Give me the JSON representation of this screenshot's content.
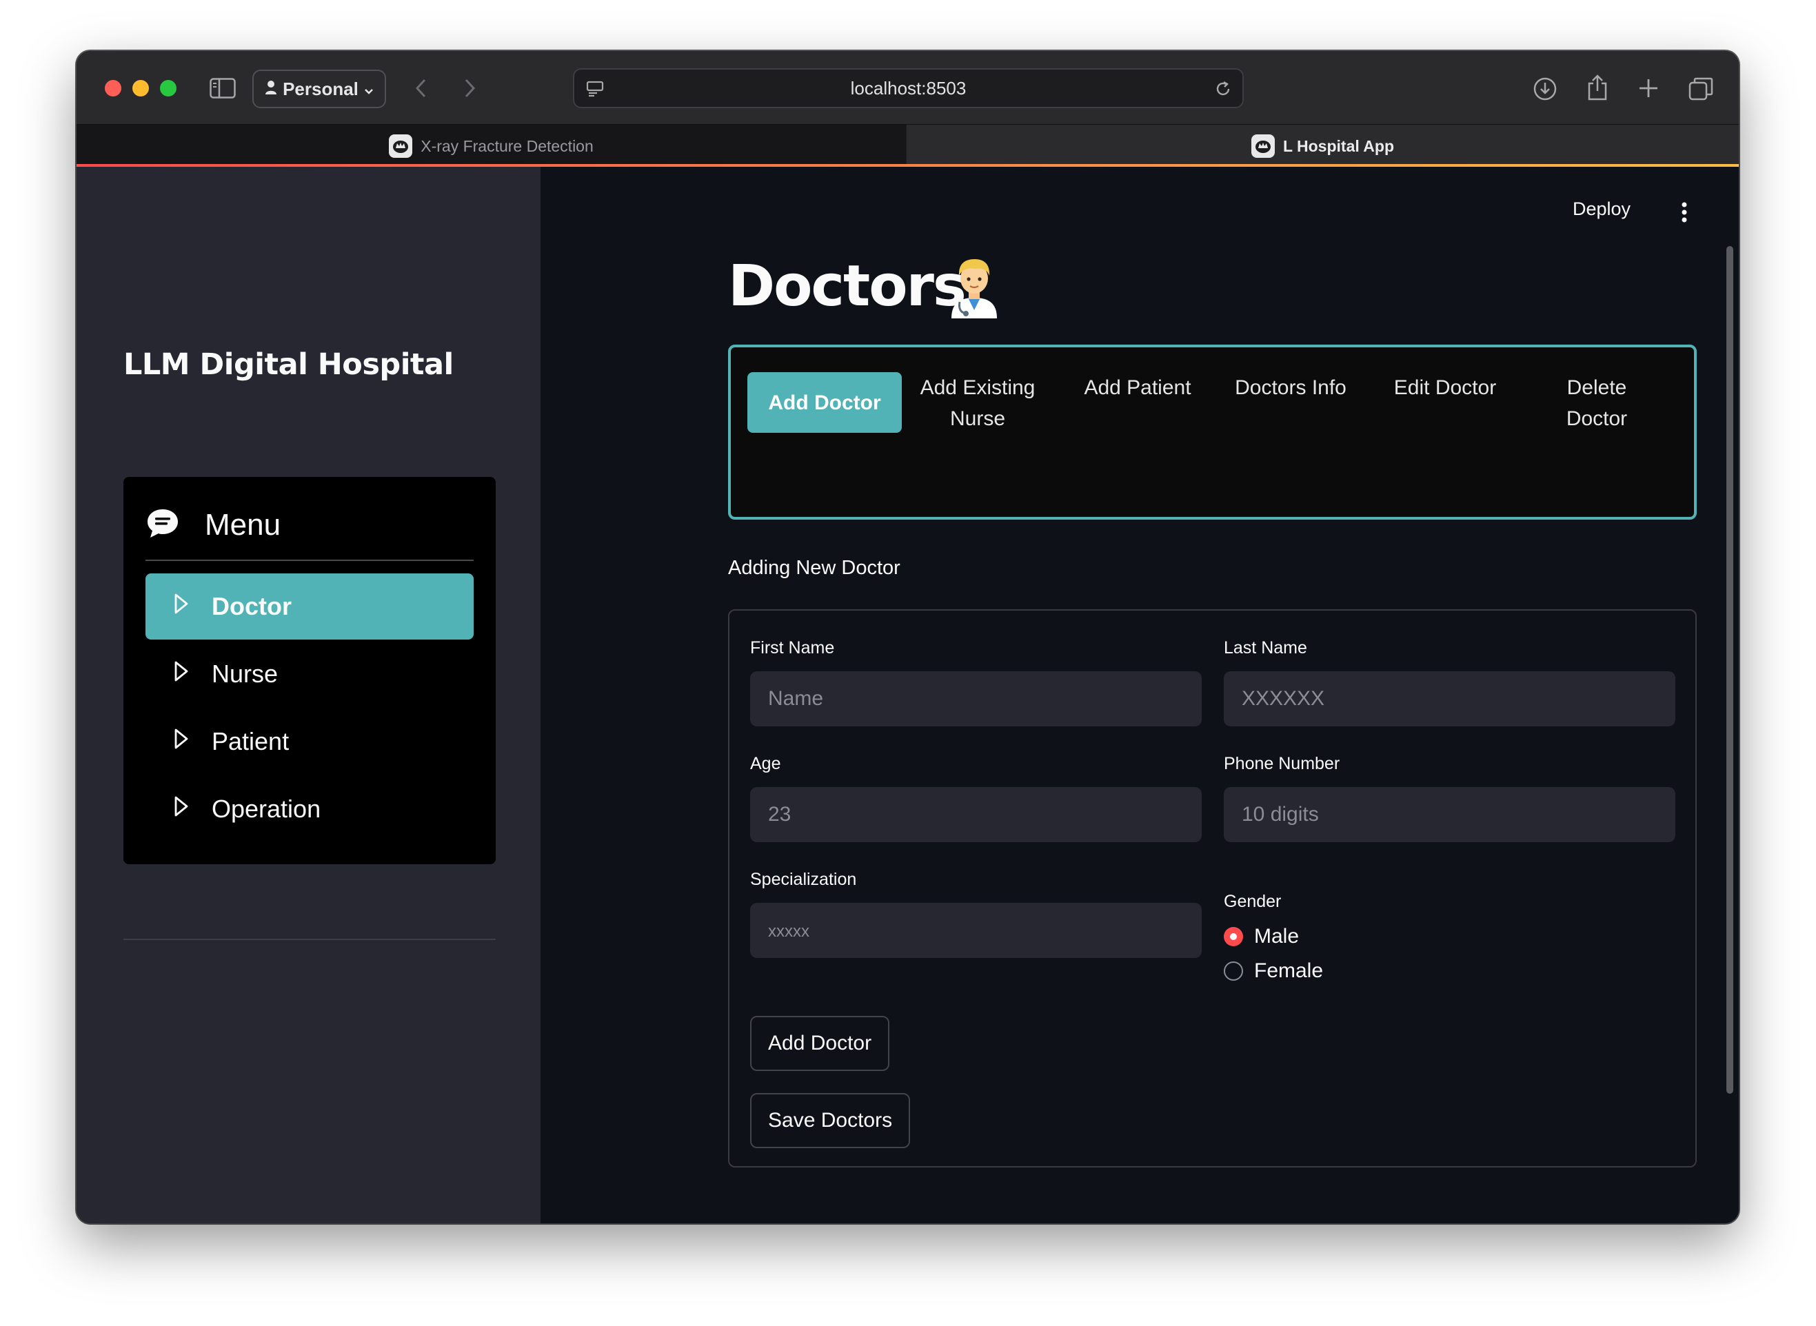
{
  "browser": {
    "profile_label": "Personal",
    "url": "localhost:8503",
    "tabs": [
      {
        "title": "X-ray Fracture Detection"
      },
      {
        "title": "L Hospital App"
      }
    ]
  },
  "sidebar": {
    "title": "LLM Digital Hospital",
    "menu_title": "Menu",
    "items": [
      {
        "label": "Doctor"
      },
      {
        "label": "Nurse"
      },
      {
        "label": "Patient"
      },
      {
        "label": "Operation"
      }
    ]
  },
  "header": {
    "deploy_label": "Deploy"
  },
  "page": {
    "title": "Doctors",
    "subnav": [
      {
        "label": "Add Doctor"
      },
      {
        "label": "Add Existing Nurse"
      },
      {
        "label": "Add Patient"
      },
      {
        "label": "Doctors Info"
      },
      {
        "label": "Edit Doctor"
      },
      {
        "label": "Delete Doctor"
      }
    ],
    "section_heading": "Adding New Doctor"
  },
  "form": {
    "first_name": {
      "label": "First Name",
      "placeholder": "Name"
    },
    "last_name": {
      "label": "Last Name",
      "placeholder": "XXXXXX"
    },
    "age": {
      "label": "Age",
      "placeholder": "23"
    },
    "phone": {
      "label": "Phone Number",
      "placeholder": "10 digits"
    },
    "specialization": {
      "label": "Specialization",
      "placeholder": "xxxxx"
    },
    "gender": {
      "label": "Gender",
      "options": [
        {
          "label": "Male"
        },
        {
          "label": "Female"
        }
      ],
      "selected": "Male"
    },
    "add_button": "Add Doctor",
    "save_button": "Save Doctors"
  },
  "colors": {
    "accent": "#52b3b6",
    "radio_selected": "#ff4b4b",
    "sidebar_bg": "#262730",
    "main_bg": "#0e1117"
  }
}
